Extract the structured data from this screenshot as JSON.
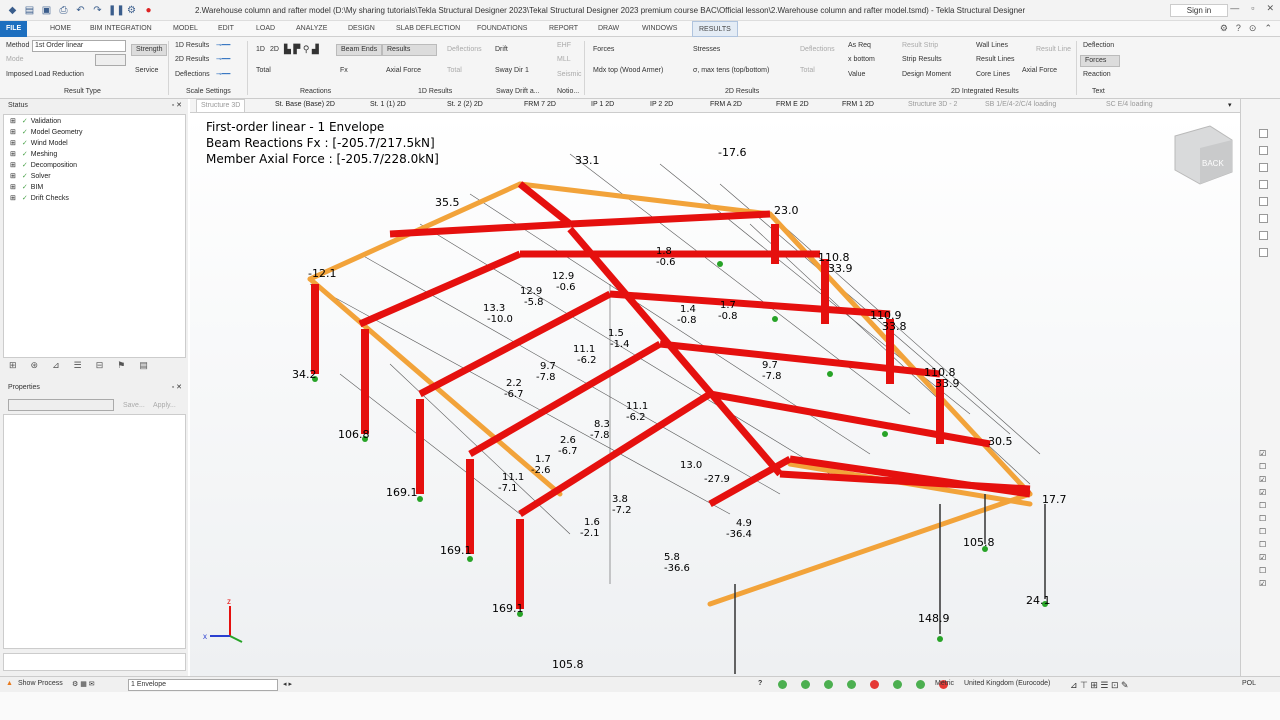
{
  "titlebar": {
    "title": "2.Warehouse column and rafter model (D:\\My sharing tutorials\\Tekla Structural Designer 2023\\Tekal Structural Designer 2023 premium course BAC\\Official lesson\\2.Warehouse column and rafter model.tsmd) - Tekla Structural Designer",
    "sign_in": "Sign in"
  },
  "menu": [
    "FILE",
    "HOME",
    "BIM INTEGRATION",
    "MODEL",
    "EDIT",
    "LOAD",
    "ANALYZE",
    "DESIGN",
    "SLAB DEFLECTION",
    "FOUNDATIONS",
    "REPORT",
    "DRAW",
    "WINDOWS",
    "RESULTS"
  ],
  "ribbon": {
    "method_label": "Method",
    "method_value": "1st Order linear",
    "mode_label": "Mode",
    "strength": "Strength",
    "service": "Service",
    "imposed": "Imposed Load Reduction",
    "results_1d": "1D Results",
    "results_2d": "2D Results",
    "deflections": "Deflections",
    "d1": "1D",
    "d2": "2D",
    "beam_ends": "Beam Ends",
    "results": "Results",
    "total": "Total",
    "fx": "Fx",
    "axial_force": "Axial Force",
    "deflections2": "Deflections",
    "total2": "Total",
    "drift": "Drift",
    "sway_dir": "Sway Dir 1",
    "ehf": "EHF",
    "mll": "MLL",
    "seismic": "Seismic",
    "forces": "Forces",
    "mdx": "Mdx top (Wood Armer)",
    "stresses": "Stresses",
    "sigma": "σ, max tens (top/bottom)",
    "deflections3": "Deflections",
    "total3": "Total",
    "as_req": "As Req",
    "x_bottom": "x bottom",
    "value": "Value",
    "result_strip": "Result Strip",
    "strip_results": "Strip Results",
    "design_moment": "Design Moment",
    "wall_lines": "Wall Lines",
    "result_lines": "Result Lines",
    "core_lines": "Core Lines",
    "result_line": "Result Line",
    "axial_force2": "Axial Force",
    "deflection": "Deflection",
    "forces2": "Forces",
    "reaction": "Reaction",
    "groups": [
      "Result Type",
      "Scale Settings",
      "Reactions",
      "1D Results",
      "Sway Drift a...",
      "Notio...",
      "2D Results",
      "2D Integrated Results",
      "Text"
    ]
  },
  "left_panel": {
    "status_title": "Status",
    "tree": [
      "Validation",
      "Model Geometry",
      "Wind Model",
      "Meshing",
      "Decomposition",
      "Solver",
      "BIM",
      "Drift Checks"
    ],
    "properties_title": "Properties",
    "save": "Save...",
    "apply": "Apply..."
  },
  "view_tabs": [
    "Structure 3D",
    "St. Base (Base) 2D",
    "St. 1 (1) 2D",
    "St. 2 (2) 2D",
    "FRM 7 2D",
    "IP 1 2D",
    "IP 2 2D",
    "FRM A 2D",
    "FRM E 2D",
    "FRM 1 2D",
    "Structure 3D - 2",
    "SB 1/E/4-2/C/4 loading",
    "SC E/4 loading"
  ],
  "viewport": {
    "line1": "First-order linear - 1 Envelope",
    "line2": "Beam Reactions Fx : [-205.7/217.5kN]",
    "line3": "Member Axial Force : [-205.7/228.0kN]",
    "cube_label": "BACK",
    "labels": [
      "33.1",
      "-17.6",
      "35.5",
      "23.0",
      "-12.1",
      "110.8",
      "33.9",
      "110.9",
      "33.8",
      "34.2",
      "110.8",
      "33.9",
      "106.8",
      "30.5",
      "169.1",
      "17.7",
      "169.1",
      "105.8",
      "169.1",
      "24.1",
      "148.9",
      "105.8",
      "12.9",
      "-5.8",
      "13.3",
      "-10.0",
      "11.1",
      "-6.2",
      "9.7",
      "-7.8",
      "8.3",
      "-7.8",
      "11.1",
      "-6.2",
      "13.0",
      "-27.9",
      "5.8",
      "-36.6",
      "4.9",
      "-36.4",
      "3.8",
      "-7.2",
      "1.6",
      "-2.1",
      "2.6",
      "-6.7",
      "2.2",
      "-6.7",
      "1.7",
      "-2.6",
      "11.1",
      "-7.1",
      "9.7",
      "-7.8",
      "1.7",
      "-0.8",
      "1.4",
      "-0.8",
      "1.5",
      "-1.4",
      "12.9",
      "-0.6",
      "1.8",
      "-0.6"
    ]
  },
  "statusbar": {
    "show_process": "Show Process",
    "envelope": "1 Envelope",
    "metric": "Metric",
    "region": "United Kingdom (Eurocode)",
    "pol": "POL",
    "status_colors": [
      "#4caf50",
      "#4caf50",
      "#4caf50",
      "#4caf50",
      "#e53935",
      "#4caf50",
      "#4caf50",
      "#e53935"
    ]
  },
  "colors": {
    "frame_red": "#e5100e",
    "rafter_orange": "#f2a33a",
    "file_blue": "#1d6fbf"
  }
}
